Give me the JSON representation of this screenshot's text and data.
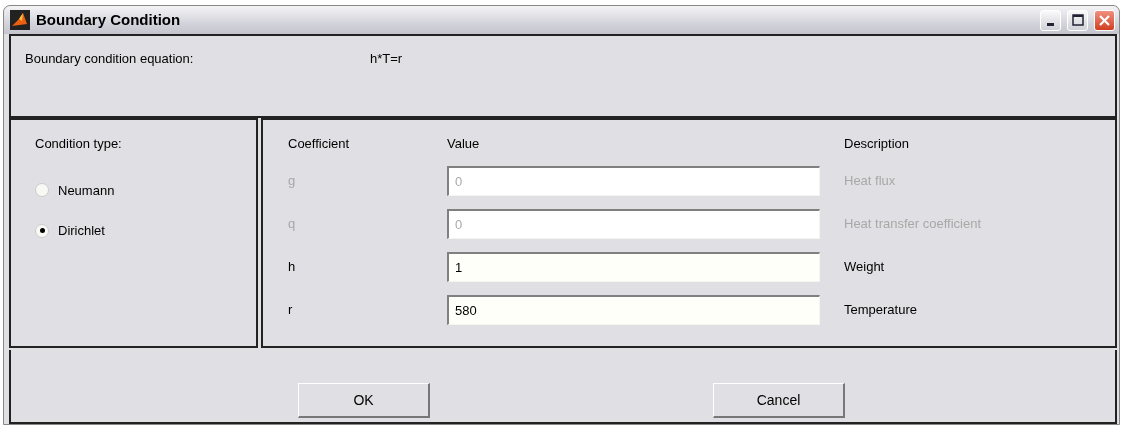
{
  "window": {
    "title": "Boundary Condition"
  },
  "equation": {
    "label": "Boundary condition equation:",
    "value": "h*T=r"
  },
  "condition_type": {
    "label": "Condition type:",
    "options": [
      {
        "label": "Neumann",
        "selected": false
      },
      {
        "label": "Dirichlet",
        "selected": true
      }
    ]
  },
  "coefficients": {
    "columns": [
      "Coefficient",
      "Value",
      "Description"
    ],
    "rows": [
      {
        "symbol": "g",
        "value": "0",
        "description": "Heat flux",
        "disabled": true
      },
      {
        "symbol": "q",
        "value": "0",
        "description": "Heat transfer coefficient",
        "disabled": true
      },
      {
        "symbol": "h",
        "value": "1",
        "description": "Weight",
        "disabled": false
      },
      {
        "symbol": "r",
        "value": "580",
        "description": "Temperature",
        "disabled": false
      }
    ]
  },
  "buttons": [
    "OK",
    "Cancel"
  ]
}
